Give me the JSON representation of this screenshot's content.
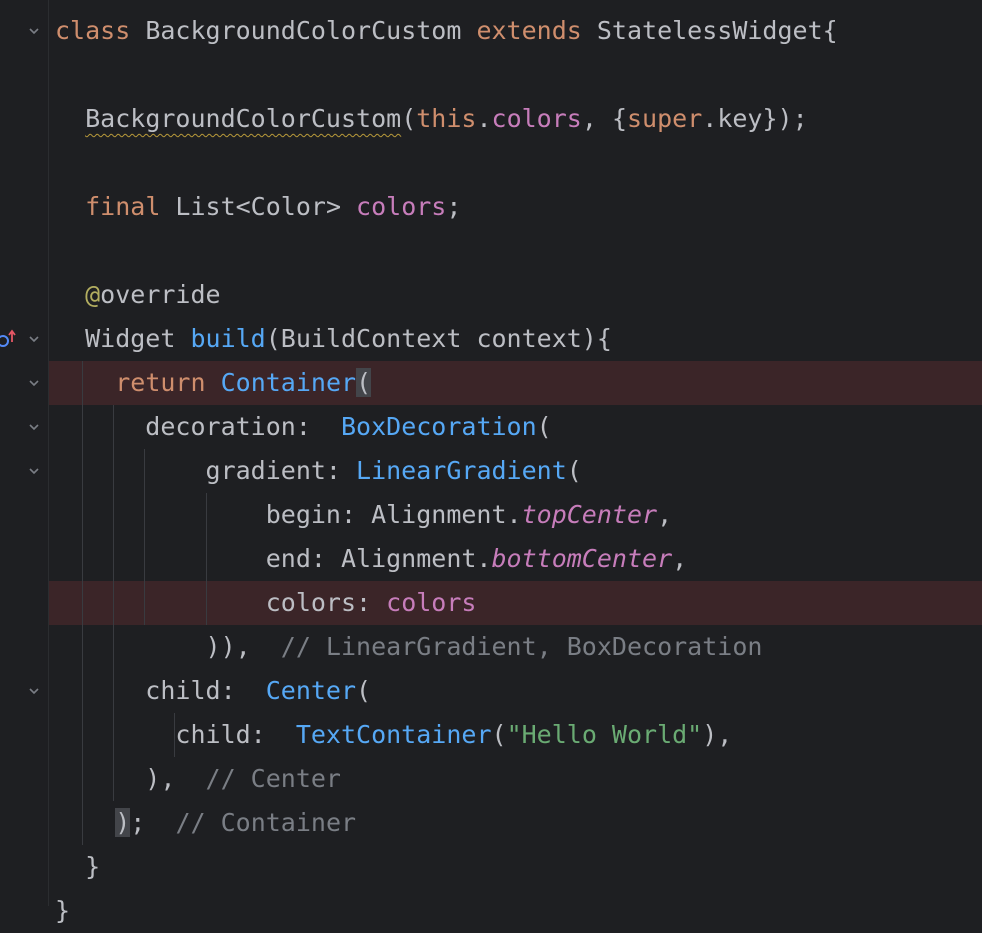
{
  "lines": [
    {
      "segments": [
        {
          "t": "class",
          "c": "kw"
        },
        {
          "t": " BackgroundColorCustom ",
          "c": "plain"
        },
        {
          "t": "extends",
          "c": "kw"
        },
        {
          "t": " StatelessWidget{",
          "c": "plain"
        }
      ]
    },
    {
      "segments": []
    },
    {
      "segments": [
        {
          "t": "  ",
          "c": "plain"
        },
        {
          "t": "BackgroundColorCustom",
          "c": "plain warn"
        },
        {
          "t": "(",
          "c": "plain"
        },
        {
          "t": "this",
          "c": "kw"
        },
        {
          "t": ".",
          "c": "plain"
        },
        {
          "t": "colors",
          "c": "field"
        },
        {
          "t": ", {",
          "c": "plain"
        },
        {
          "t": "super",
          "c": "kw"
        },
        {
          "t": ".key});",
          "c": "plain"
        }
      ]
    },
    {
      "segments": []
    },
    {
      "segments": [
        {
          "t": "  ",
          "c": "plain"
        },
        {
          "t": "final",
          "c": "kw"
        },
        {
          "t": " List<Color> ",
          "c": "plain"
        },
        {
          "t": "colors",
          "c": "field"
        },
        {
          "t": ";",
          "c": "plain"
        }
      ]
    },
    {
      "segments": []
    },
    {
      "segments": [
        {
          "t": "  ",
          "c": "plain"
        },
        {
          "t": "@",
          "c": "ann"
        },
        {
          "t": "override",
          "c": "plain"
        }
      ]
    },
    {
      "segments": [
        {
          "t": "  Widget ",
          "c": "plain"
        },
        {
          "t": "build",
          "c": "fn"
        },
        {
          "t": "(BuildContext context){",
          "c": "plain"
        }
      ]
    },
    {
      "segments": [
        {
          "t": "    ",
          "c": "plain"
        },
        {
          "t": "return",
          "c": "kw"
        },
        {
          "t": " ",
          "c": "plain"
        },
        {
          "t": "Container",
          "c": "fn"
        },
        {
          "t": "(",
          "c": "plain caret-bg"
        }
      ]
    },
    {
      "segments": [
        {
          "t": "      decoration:  ",
          "c": "plain"
        },
        {
          "t": "BoxDecoration",
          "c": "fn"
        },
        {
          "t": "(",
          "c": "plain"
        }
      ]
    },
    {
      "segments": [
        {
          "t": "          gradient: ",
          "c": "plain"
        },
        {
          "t": "LinearGradient",
          "c": "fn"
        },
        {
          "t": "(",
          "c": "plain"
        }
      ]
    },
    {
      "segments": [
        {
          "t": "              begin: Alignment.",
          "c": "plain"
        },
        {
          "t": "topCenter",
          "c": "ital"
        },
        {
          "t": ",",
          "c": "plain"
        }
      ]
    },
    {
      "segments": [
        {
          "t": "              end: Alignment.",
          "c": "plain"
        },
        {
          "t": "bottomCenter",
          "c": "ital"
        },
        {
          "t": ",",
          "c": "plain"
        }
      ]
    },
    {
      "segments": [
        {
          "t": "              colors: ",
          "c": "plain"
        },
        {
          "t": "colors",
          "c": "field"
        }
      ]
    },
    {
      "segments": [
        {
          "t": "          )),  ",
          "c": "plain"
        },
        {
          "t": "// LinearGradient, BoxDecoration",
          "c": "cmt"
        }
      ]
    },
    {
      "segments": [
        {
          "t": "      child:  ",
          "c": "plain"
        },
        {
          "t": "Center",
          "c": "fn"
        },
        {
          "t": "(",
          "c": "plain"
        }
      ]
    },
    {
      "segments": [
        {
          "t": "        child:  ",
          "c": "plain"
        },
        {
          "t": "TextContainer",
          "c": "fn"
        },
        {
          "t": "(",
          "c": "plain"
        },
        {
          "t": "\"Hello World\"",
          "c": "str"
        },
        {
          "t": "),",
          "c": "plain"
        }
      ]
    },
    {
      "segments": [
        {
          "t": "      ),  ",
          "c": "plain"
        },
        {
          "t": "// Center",
          "c": "cmt"
        }
      ]
    },
    {
      "segments": [
        {
          "t": "    ",
          "c": "plain"
        },
        {
          "t": ")",
          "c": "plain caret-bg"
        },
        {
          "t": ";  ",
          "c": "plain"
        },
        {
          "t": "// Container",
          "c": "cmt"
        }
      ]
    },
    {
      "segments": [
        {
          "t": "  }",
          "c": "plain"
        }
      ]
    },
    {
      "segments": [
        {
          "t": "}",
          "c": "plain"
        }
      ]
    }
  ],
  "highlighted_lines": [
    8,
    13
  ],
  "fold_lines": [
    0,
    7,
    8,
    9,
    10,
    15
  ],
  "override_marker_line": 7,
  "icons": {
    "fold": "chevron-down-icon",
    "override": "override-gutter-icon"
  }
}
